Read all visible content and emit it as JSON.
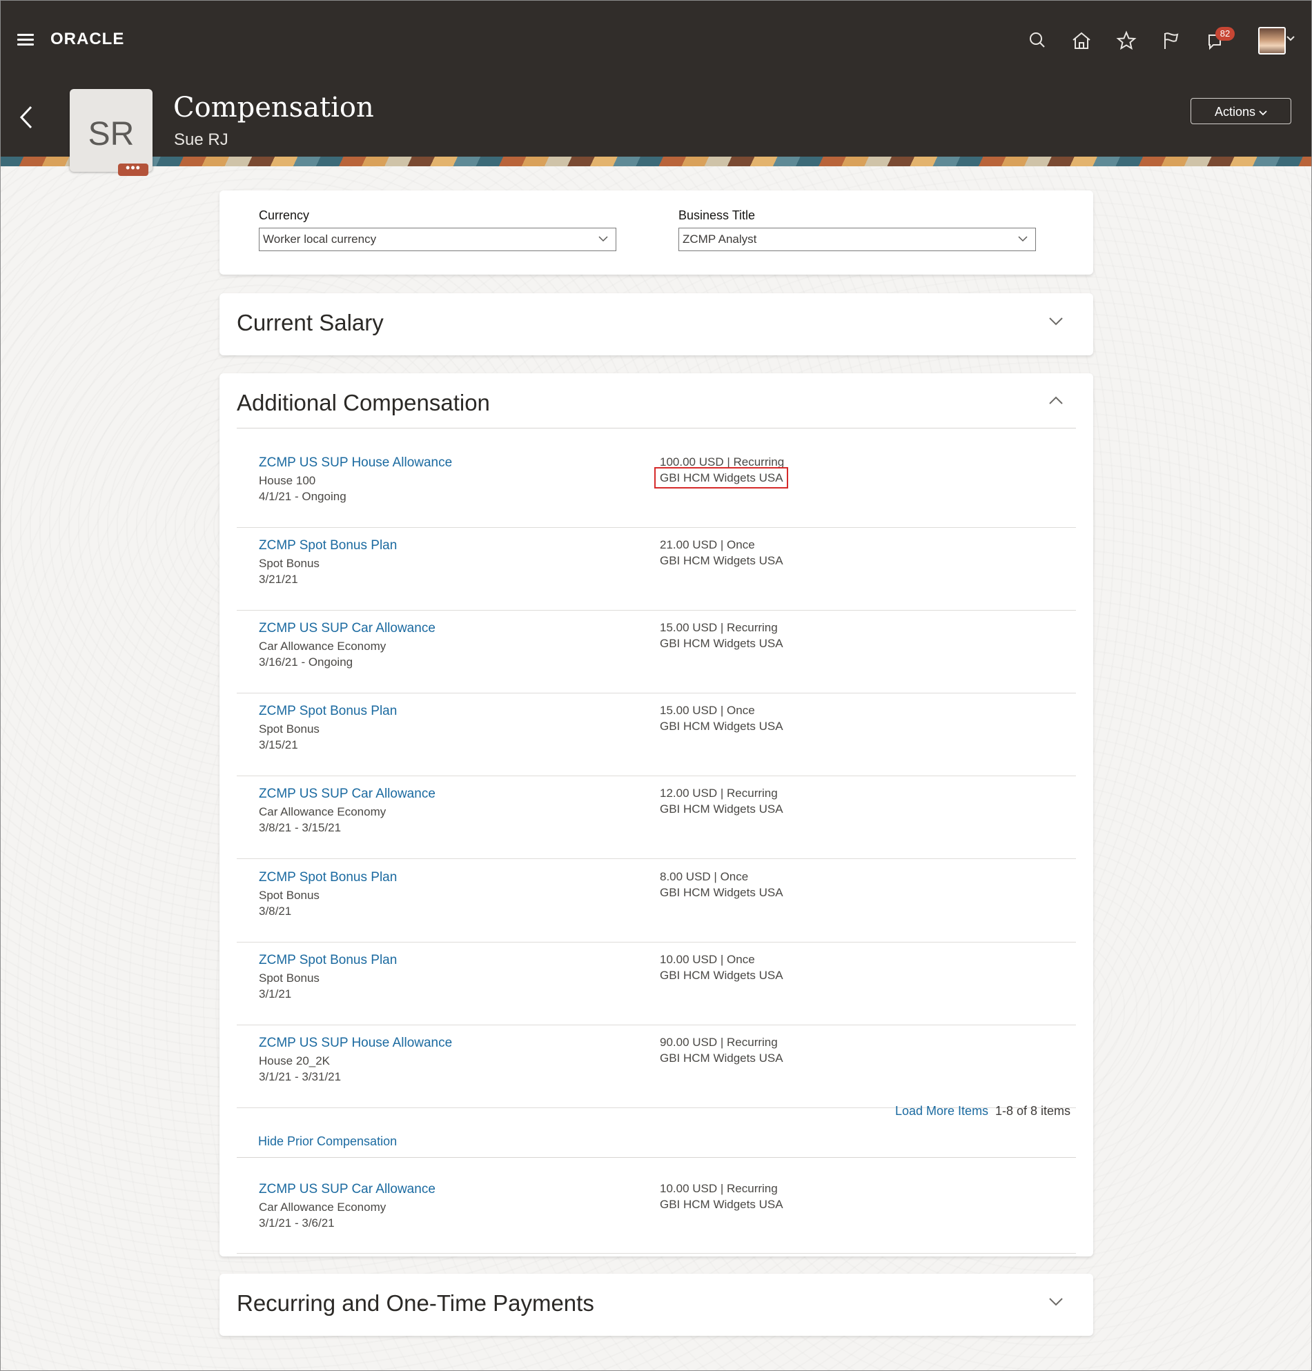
{
  "header": {
    "logo": "ORACLE",
    "notification_count": "82",
    "title": "Compensation",
    "person_name": "Sue RJ",
    "initials": "SR",
    "more_label": "•••",
    "actions_label": "Actions"
  },
  "filters": {
    "currency_label": "Currency",
    "currency_value": "Worker local currency",
    "business_title_label": "Business Title",
    "business_title_value": "ZCMP Analyst"
  },
  "sections": {
    "current_salary": "Current Salary",
    "additional_compensation": "Additional Compensation",
    "recurring_payments": "Recurring and One-Time Payments"
  },
  "compensation_items": [
    {
      "name": "ZCMP US SUP House Allowance",
      "detail": "House 100",
      "dates": "4/1/21 - Ongoing",
      "amount": "100.00 USD | Recurring",
      "org": "GBI HCM Widgets USA"
    },
    {
      "name": "ZCMP Spot Bonus Plan",
      "detail": "Spot Bonus",
      "dates": "3/21/21",
      "amount": "21.00 USD | Once",
      "org": "GBI HCM Widgets USA"
    },
    {
      "name": "ZCMP US SUP Car Allowance",
      "detail": "Car Allowance Economy",
      "dates": "3/16/21 - Ongoing",
      "amount": "15.00 USD | Recurring",
      "org": "GBI HCM Widgets USA"
    },
    {
      "name": "ZCMP Spot Bonus Plan",
      "detail": "Spot Bonus",
      "dates": "3/15/21",
      "amount": "15.00 USD | Once",
      "org": "GBI HCM Widgets USA"
    },
    {
      "name": "ZCMP US SUP Car Allowance",
      "detail": "Car Allowance Economy",
      "dates": "3/8/21 - 3/15/21",
      "amount": "12.00 USD | Recurring",
      "org": "GBI HCM Widgets USA"
    },
    {
      "name": "ZCMP Spot Bonus Plan",
      "detail": "Spot Bonus",
      "dates": "3/8/21",
      "amount": "8.00 USD | Once",
      "org": "GBI HCM Widgets USA"
    },
    {
      "name": "ZCMP Spot Bonus Plan",
      "detail": "Spot Bonus",
      "dates": "3/1/21",
      "amount": "10.00 USD | Once",
      "org": "GBI HCM Widgets USA"
    },
    {
      "name": "ZCMP US SUP House Allowance",
      "detail": "House 20_2K",
      "dates": "3/1/21 - 3/31/21",
      "amount": "90.00 USD | Recurring",
      "org": "GBI HCM Widgets USA"
    }
  ],
  "pagination": {
    "load_more": "Load More Items",
    "count": "1-8 of 8 items"
  },
  "prior": {
    "hide_label": "Hide Prior Compensation",
    "items": [
      {
        "name": "ZCMP US SUP Car Allowance",
        "detail": "Car Allowance Economy",
        "dates": "3/1/21 - 3/6/21",
        "amount": "10.00 USD | Recurring",
        "org": "GBI HCM Widgets USA"
      }
    ]
  },
  "colors": {
    "header_bg": "#312d2a",
    "link": "#1b6aa0",
    "badge": "#c74634",
    "highlight": "#d62a2a"
  }
}
